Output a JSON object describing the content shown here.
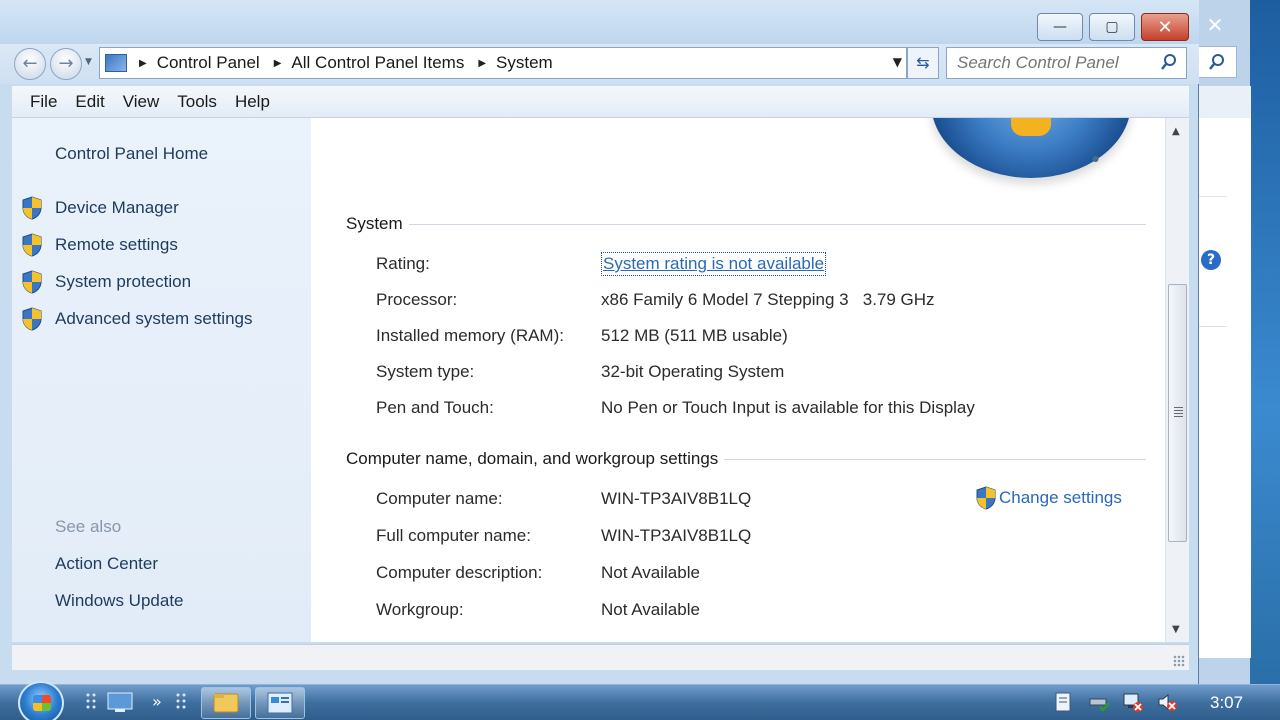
{
  "window": {
    "title": "System"
  },
  "caption_buttons": {
    "minimize": "—",
    "maximize": "▢",
    "close": "✕"
  },
  "address": {
    "crumbs": [
      "Control Panel",
      "All Control Panel Items",
      "System"
    ]
  },
  "search": {
    "placeholder": "Search Control Panel"
  },
  "menu": {
    "items": [
      "File",
      "Edit",
      "View",
      "Tools",
      "Help"
    ]
  },
  "sidebar": {
    "home": "Control Panel Home",
    "tasks": [
      "Device Manager",
      "Remote settings",
      "System protection",
      "Advanced system settings"
    ],
    "see_also_title": "See also",
    "see_also": [
      "Action Center",
      "Windows Update"
    ]
  },
  "system": {
    "heading": "System",
    "rows": [
      {
        "label": "Rating:",
        "value": "System rating is not available"
      },
      {
        "label": "Processor:",
        "value": "x86 Family 6 Model 7 Stepping 3   3.79 GHz"
      },
      {
        "label": "Installed memory (RAM):",
        "value": "512 MB (511 MB usable)"
      },
      {
        "label": "System type:",
        "value": "32-bit Operating System"
      },
      {
        "label": "Pen and Touch:",
        "value": "No Pen or Touch Input is available for this Display"
      }
    ]
  },
  "computer": {
    "heading": "Computer name, domain, and workgroup settings",
    "change_settings": "Change settings",
    "rows": [
      {
        "label": "Computer name:",
        "value": "WIN-TP3AIV8B1LQ"
      },
      {
        "label": "Full computer name:",
        "value": "WIN-TP3AIV8B1LQ"
      },
      {
        "label": "Computer description:",
        "value": "Not Available"
      },
      {
        "label": "Workgroup:",
        "value": "Not Available"
      }
    ]
  },
  "taskbar": {
    "clock": "3:07"
  },
  "colors": {
    "link": "#2a68b8",
    "accent": "#3d7ec6"
  }
}
